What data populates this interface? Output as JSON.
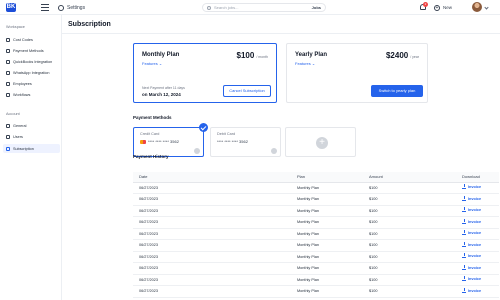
{
  "topbar": {
    "logo_text": "BK",
    "settings_label": "Settings",
    "search_placeholder": "Search jobs...",
    "search_scope": "Jobs",
    "notification_count": "2",
    "new_label": "New"
  },
  "sidebar": {
    "workspace_title": "Workspace",
    "workspace_items": [
      {
        "label": "Cost Codes"
      },
      {
        "label": "Payment Methods"
      },
      {
        "label": "QuickBooks Integration"
      },
      {
        "label": "WhatsApp Integration"
      },
      {
        "label": "Employees"
      },
      {
        "label": "Workflows"
      }
    ],
    "account_title": "Account",
    "account_items": [
      {
        "label": "General"
      },
      {
        "label": "Users"
      },
      {
        "label": "Subscription",
        "active": true
      }
    ]
  },
  "main": {
    "title": "Subscription",
    "monthly": {
      "name": "Monthly Plan",
      "features": "Features",
      "price": "$100",
      "period": "/ month",
      "next_label": "Next Payment after 11 days",
      "next_date": "on March 12, 2024",
      "cancel_label": "Cancel Subscription"
    },
    "yearly": {
      "name": "Yearly Plan",
      "features": "Features",
      "price": "$2400",
      "period": "/ year",
      "switch_label": "Switch to yearly plan"
    },
    "payment_methods_title": "Payment Methods",
    "cards": [
      {
        "type": "Credit Card",
        "number": "**** **** **** 3562"
      },
      {
        "type": "Debit Card",
        "number": "**** **** **** 3562"
      }
    ],
    "history_title": "Payment History",
    "history_headers": [
      "Date",
      "Plan",
      "Amount",
      "Download"
    ],
    "history_rows": [
      {
        "date": "06/27/2023",
        "plan": "Monthly Plan",
        "amount": "$100",
        "download": "Invoice"
      },
      {
        "date": "06/27/2023",
        "plan": "Monthly Plan",
        "amount": "$100",
        "download": "Invoice"
      },
      {
        "date": "06/27/2023",
        "plan": "Monthly Plan",
        "amount": "$100",
        "download": "Invoice"
      },
      {
        "date": "06/27/2023",
        "plan": "Monthly Plan",
        "amount": "$100",
        "download": "Invoice"
      },
      {
        "date": "06/27/2023",
        "plan": "Monthly Plan",
        "amount": "$100",
        "download": "Invoice"
      },
      {
        "date": "06/27/2023",
        "plan": "Monthly Plan",
        "amount": "$100",
        "download": "Invoice"
      },
      {
        "date": "06/27/2023",
        "plan": "Monthly Plan",
        "amount": "$100",
        "download": "Invoice"
      },
      {
        "date": "06/27/2023",
        "plan": "Monthly Plan",
        "amount": "$100",
        "download": "Invoice"
      },
      {
        "date": "06/27/2023",
        "plan": "Monthly Plan",
        "amount": "$100",
        "download": "Invoice"
      },
      {
        "date": "06/27/2023",
        "plan": "Monthly Plan",
        "amount": "$100",
        "download": "Invoice"
      }
    ]
  },
  "icons": {
    "logo": "logo-mark",
    "menu": "hamburger-icon",
    "settings": "gear-icon",
    "search": "search-icon",
    "notifications": "bell-icon",
    "new": "plus-circle-icon",
    "download": "download-icon"
  },
  "colors": {
    "accent": "#2563eb",
    "badge": "#ef4444"
  }
}
